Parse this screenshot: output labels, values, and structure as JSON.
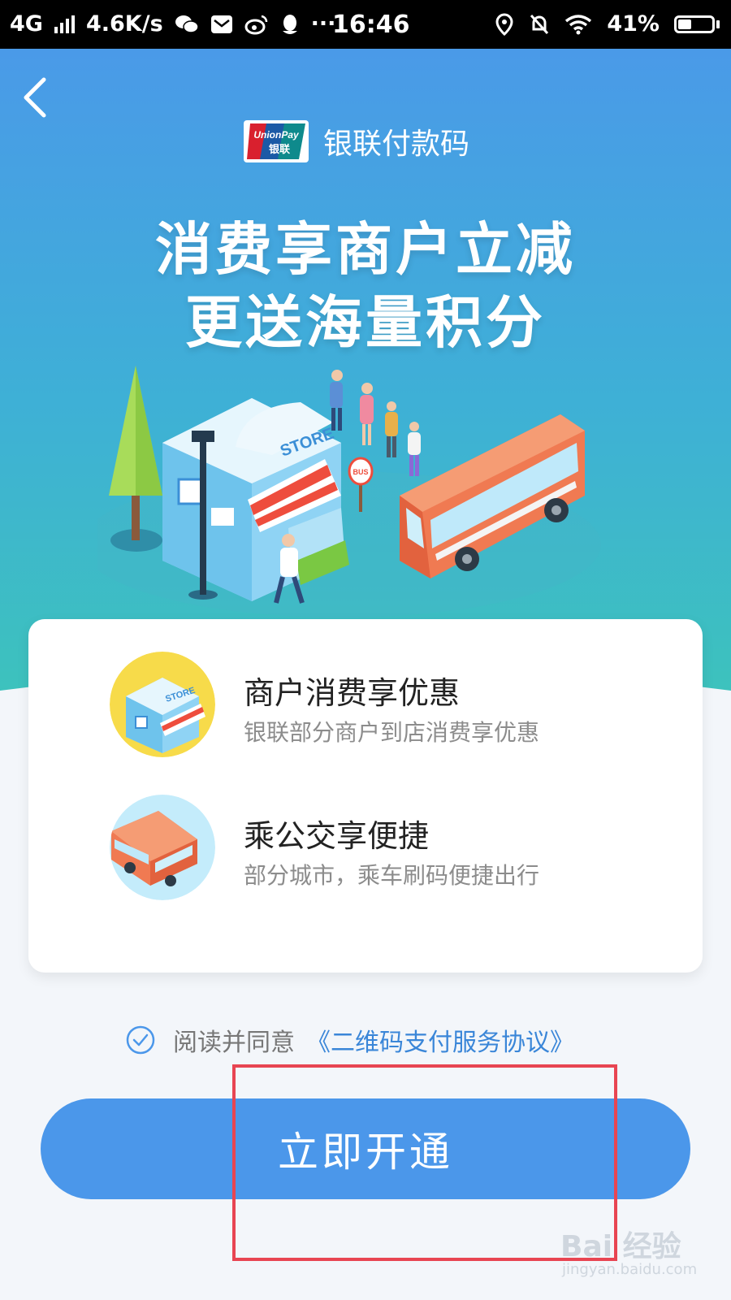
{
  "status_bar": {
    "network": "4G",
    "speed": "4.6K/s",
    "more": "···",
    "time": "16:46",
    "battery": "41%",
    "battery_level": 0.41
  },
  "header": {
    "brand_logo_line1": "UnionPay",
    "brand_logo_line2": "银联",
    "brand_name": "银联付款码"
  },
  "hero": {
    "headline_line1": "消费享商户立减",
    "headline_line2": "更送海量积分",
    "store_sign": "STORE",
    "bus_sign": "BUS"
  },
  "features": [
    {
      "title": "商户消费享优惠",
      "subtitle": "银联部分商户到店消费享优惠",
      "icon": "store-icon"
    },
    {
      "title": "乘公交享便捷",
      "subtitle": "部分城市，乘车刷码便捷出行",
      "icon": "bus-icon"
    }
  ],
  "agreement": {
    "prefix": "阅读并同意",
    "link": "《二维码支付服务协议》"
  },
  "action": {
    "open_label": "立即开通"
  },
  "watermark": {
    "brand": "Bai 经验",
    "url": "jingyan.baidu.com"
  },
  "colors": {
    "primary": "#4b97ea",
    "link": "#3a86d8",
    "hero_top": "#4a9ae8",
    "hero_bottom": "#3dc2bd",
    "highlight_frame": "#e84552"
  }
}
